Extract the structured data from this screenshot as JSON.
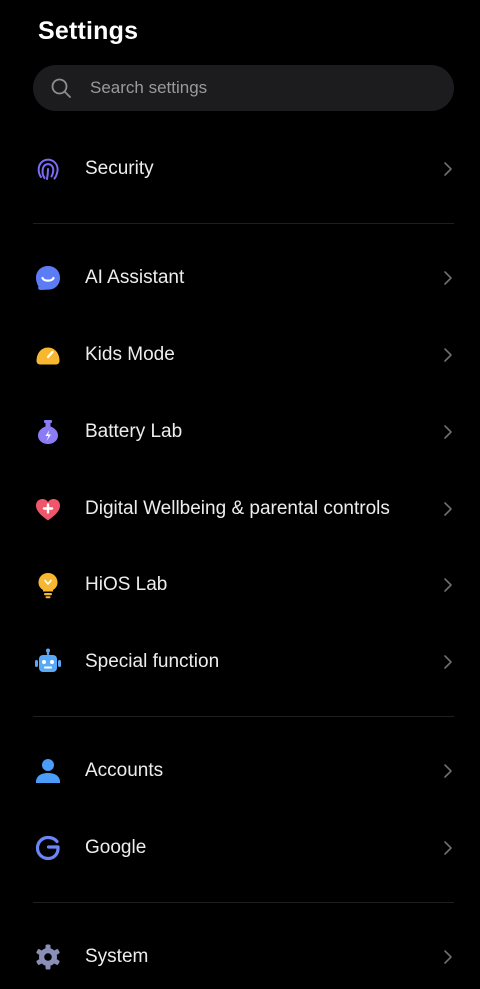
{
  "header": {
    "title": "Settings"
  },
  "search": {
    "placeholder": "Search settings",
    "icon": "search-icon"
  },
  "groups": [
    {
      "items": [
        {
          "label": "Security",
          "icon": "fingerprint-icon",
          "color": "#7B6CF6"
        }
      ]
    },
    {
      "items": [
        {
          "label": "AI Assistant",
          "icon": "ai-assistant-icon",
          "color": "#5B7CF5"
        },
        {
          "label": "Kids Mode",
          "icon": "kids-mode-icon",
          "color": "#F7B731"
        },
        {
          "label": "Battery Lab",
          "icon": "battery-lab-icon",
          "color": "#8B7CF6"
        },
        {
          "label": "Digital Wellbeing & parental controls",
          "icon": "heart-plus-icon",
          "color": "#F0566A"
        },
        {
          "label": "HiOS Lab",
          "icon": "lightbulb-icon",
          "color": "#F7B731"
        },
        {
          "label": "Special function",
          "icon": "robot-icon",
          "color": "#5AA9F7"
        }
      ]
    },
    {
      "items": [
        {
          "label": "Accounts",
          "icon": "person-icon",
          "color": "#4A9DF8"
        },
        {
          "label": "Google",
          "icon": "google-g-icon",
          "color": "#6B86F7"
        }
      ]
    },
    {
      "items": [
        {
          "label": "System",
          "icon": "gear-icon",
          "color": "#8A8FB8"
        }
      ]
    }
  ],
  "colors": {
    "background": "#000000",
    "search_background": "#1C1C1E",
    "divider": "#1F1F1F",
    "chevron": "#6E6E6E"
  }
}
